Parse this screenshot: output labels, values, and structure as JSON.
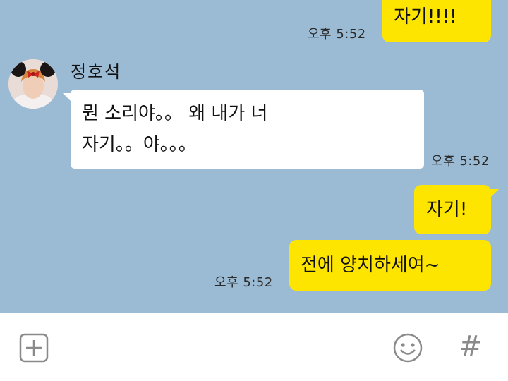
{
  "chat": {
    "background": "#9bbbd4",
    "my_bubble_color": "#fee500",
    "their_bubble_color": "#ffffff",
    "messages": [
      {
        "from": "me",
        "text": "자기!!!!",
        "time": "오후 5:52"
      },
      {
        "from": "them",
        "sender": "정호석",
        "lines": [
          "뭔 소리야。。 왜 내가 너",
          "자기。。야。。。"
        ],
        "time": "오후 5:52"
      },
      {
        "from": "me",
        "text": "자기!"
      },
      {
        "from": "me",
        "text": "전에 양치하세여~",
        "time": "오후 5:52"
      }
    ]
  },
  "input_bar": {
    "left_icon": "add-icon",
    "emoji_icon": "emoji-icon",
    "hash_icon": "hashtag-icon",
    "hash_glyph": "#"
  }
}
